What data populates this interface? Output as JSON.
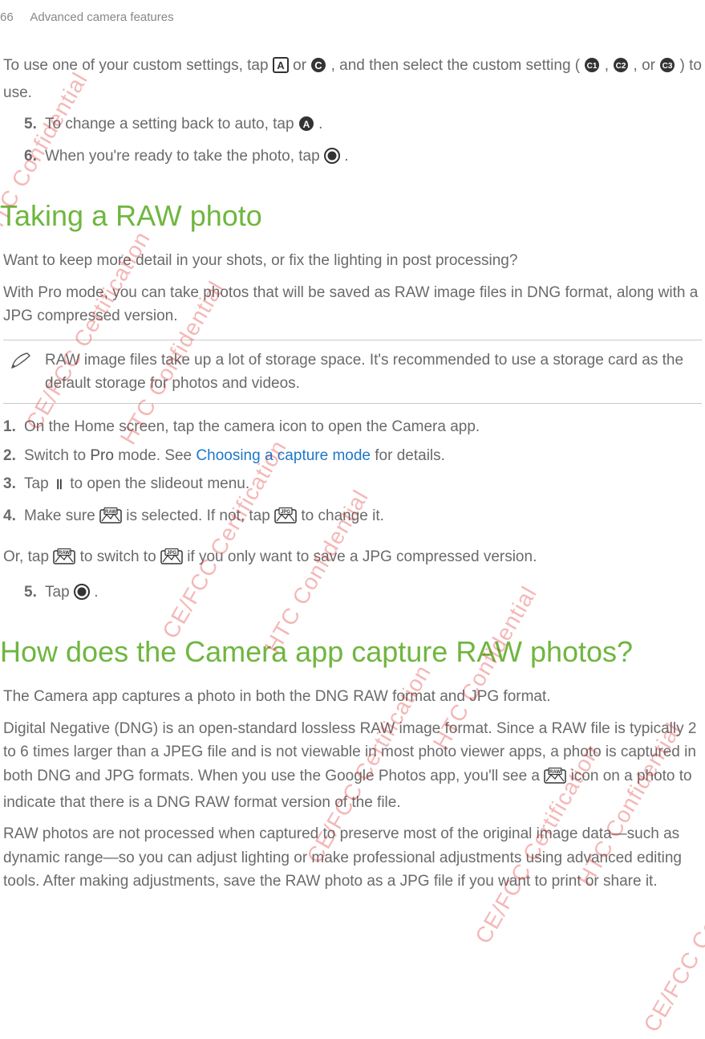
{
  "header": {
    "page_number": "66",
    "chapter_title": "Advanced camera features"
  },
  "para1_a": "To use one of your custom settings, tap ",
  "para1_b": " or ",
  "para1_c": ", and then select the custom setting (",
  "para1_d": ", ",
  "para1_e": ", or ",
  "para1_f": ") to use.",
  "list1": {
    "item5_num": "5.",
    "item5_a": "To change a setting back to auto, tap ",
    "item5_b": ".",
    "item6_num": "6.",
    "item6_a": "When you're ready to take the photo, tap ",
    "item6_b": "."
  },
  "section1_title": "Taking a RAW photo",
  "section1_p1": " Want to keep more detail in your shots, or fix the lighting in post processing?",
  "section1_p2": "With Pro mode, you can take photos that will be saved as RAW image files in DNG format, along with a JPG compressed version.",
  "note1": "RAW image files take up a lot of storage space. It's recommended to use a storage card as the default storage for photos and videos.",
  "list2": {
    "item1_num": "1.",
    "item1_text": "On the Home screen, tap the camera icon to open the Camera app.",
    "item2_num": "2.",
    "item2_a": "Switch to ",
    "item2_pro": "Pro",
    "item2_b": " mode. See ",
    "item2_link": "Choosing a capture mode",
    "item2_c": " for details.",
    "item3_num": "3.",
    "item3_a": "Tap ",
    "item3_b": " to open the slideout menu.",
    "item4_num": "4.",
    "item4_a": "Make sure ",
    "item4_b": " is selected. If not, tap ",
    "item4_c": " to change it."
  },
  "para_or_a": "Or, tap ",
  "para_or_b": " to switch to ",
  "para_or_c": " if you only want to save a JPG compressed version.",
  "list3": {
    "item5_num": "5.",
    "item5_a": "Tap ",
    "item5_b": "."
  },
  "section2_title": "How does the Camera app capture RAW photos?",
  "section2_p1": "The Camera app captures a photo in both the DNG RAW format and JPG format.",
  "section2_p2a": "Digital Negative (DNG) is an open-standard lossless RAW image format. Since a RAW file is typically 2 to 6 times larger than a JPEG file and is not viewable in most photo viewer apps, a photo is captured in both DNG and JPG formats. When you use the Google Photos app, you'll see a ",
  "section2_p2b": " icon on a photo to indicate that there is a DNG RAW format version of the file.",
  "section2_p3": "RAW photos are not processed when captured to preserve most of the original image data—such as dynamic range—so you can adjust lighting or make professional adjustments using advanced editing tools. After making adjustments, save the RAW photo as a JPG file if you want to print or share it.",
  "watermark_text1": "HTC Confidential",
  "watermark_text2": "CE/FCC Certification"
}
